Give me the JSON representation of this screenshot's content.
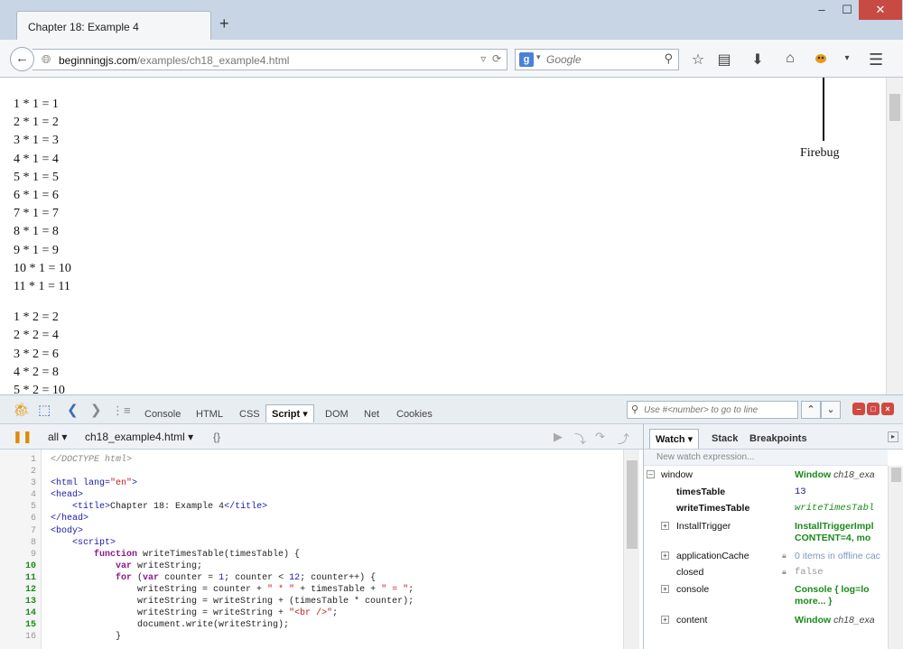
{
  "window": {
    "tab_title": "Chapter 18: Example 4",
    "new_tab": "+",
    "minimize": "–",
    "maximize": "☐",
    "close": "✕"
  },
  "navbar": {
    "url_domain": "beginningjs.com",
    "url_path": "/examples/ch18_example4.html",
    "search_engine": "g",
    "search_placeholder": "Google"
  },
  "content": {
    "lines": [
      "1 * 1 = 1",
      "2 * 1 = 2",
      "3 * 1 = 3",
      "4 * 1 = 4",
      "5 * 1 = 5",
      "6 * 1 = 6",
      "7 * 1 = 7",
      "8 * 1 = 8",
      "9 * 1 = 9",
      "10 * 1 = 10",
      "11 * 1 = 11",
      "",
      "1 * 2 = 2",
      "2 * 2 = 4",
      "3 * 2 = 6",
      "4 * 2 = 8",
      "5 * 2 = 10"
    ],
    "annotation": "Firebug"
  },
  "firebug": {
    "tabs": [
      "Console",
      "HTML",
      "CSS",
      "Script ▾",
      "DOM",
      "Net",
      "Cookies"
    ],
    "active_tab": "Script ▾",
    "line_search_placeholder": "Use #<number> to go to line",
    "script_filter": "all ▾",
    "script_file": "ch18_example4.html ▾",
    "braces": "{}",
    "code_lines": [
      {
        "n": "1",
        "exec": false
      },
      {
        "n": "2",
        "exec": false
      },
      {
        "n": "3",
        "exec": false
      },
      {
        "n": "4",
        "exec": false
      },
      {
        "n": "5",
        "exec": false
      },
      {
        "n": "6",
        "exec": false
      },
      {
        "n": "7",
        "exec": false
      },
      {
        "n": "8",
        "exec": false
      },
      {
        "n": "9",
        "exec": false
      },
      {
        "n": "10",
        "exec": true
      },
      {
        "n": "11",
        "exec": true
      },
      {
        "n": "12",
        "exec": true
      },
      {
        "n": "13",
        "exec": true
      },
      {
        "n": "14",
        "exec": true
      },
      {
        "n": "15",
        "exec": true
      },
      {
        "n": "16",
        "exec": false
      }
    ]
  },
  "watch": {
    "tabs": [
      "Watch ▾",
      "Stack",
      "Breakpoints"
    ],
    "new_expression": "New watch expression...",
    "rows": [
      {
        "name": "window",
        "value": "Window",
        "value_italic": "ch18_exa"
      },
      {
        "name": "timesTable",
        "value": "13"
      },
      {
        "name": "writeTimesTable",
        "value": "writeTimesTabl"
      },
      {
        "name": "InstallTrigger",
        "value": "InstallTriggerImpl",
        "value2": "CONTENT=4,  mo"
      },
      {
        "name": "applicationCache",
        "value": "0 items in offline cac"
      },
      {
        "name": "closed",
        "value": "false"
      },
      {
        "name": "console",
        "value": "Console {  log=lo",
        "value2": "more... }"
      },
      {
        "name": "content",
        "value": "Window",
        "value_italic": "ch18_exa"
      }
    ]
  }
}
